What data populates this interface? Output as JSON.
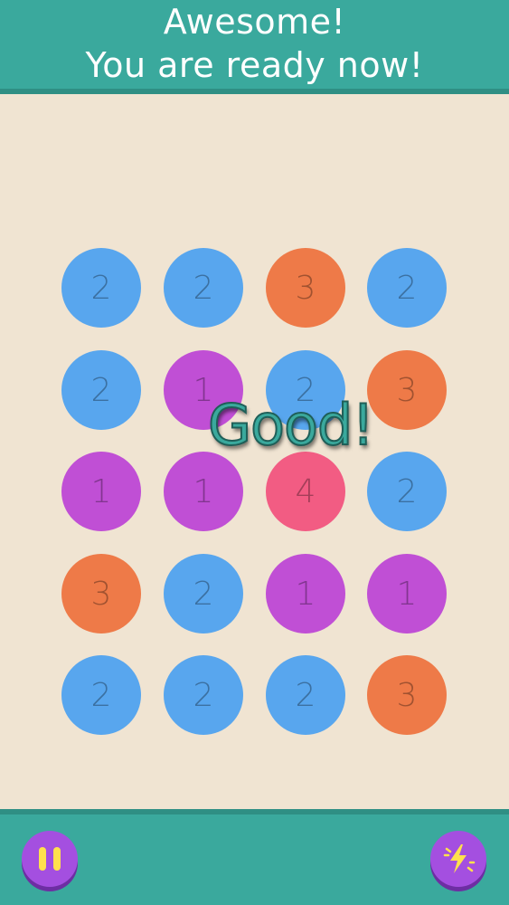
{
  "header": {
    "line1": "Awesome!",
    "line2": "You are ready now!"
  },
  "feedback": {
    "text": "Good!"
  },
  "colors": {
    "blue": "#58a6ee",
    "orange": "#ee7a48",
    "purple": "#c04fd5",
    "pink": "#f25c83",
    "teal": "#3aa99d",
    "button": "#a44fe0",
    "button_icon": "#ffe14d"
  },
  "board": {
    "rows": [
      [
        {
          "value": "2",
          "color": "blue"
        },
        {
          "value": "2",
          "color": "blue"
        },
        {
          "value": "3",
          "color": "orange"
        },
        {
          "value": "2",
          "color": "blue"
        }
      ],
      [
        {
          "value": "2",
          "color": "blue"
        },
        {
          "value": "1",
          "color": "purple"
        },
        {
          "value": "2",
          "color": "blue"
        },
        {
          "value": "3",
          "color": "orange"
        }
      ],
      [
        {
          "value": "1",
          "color": "purple"
        },
        {
          "value": "1",
          "color": "purple"
        },
        {
          "value": "4",
          "color": "pink"
        },
        {
          "value": "2",
          "color": "blue"
        }
      ],
      [
        {
          "value": "3",
          "color": "orange"
        },
        {
          "value": "2",
          "color": "blue"
        },
        {
          "value": "1",
          "color": "purple"
        },
        {
          "value": "1",
          "color": "purple"
        }
      ],
      [
        {
          "value": "2",
          "color": "blue"
        },
        {
          "value": "2",
          "color": "blue"
        },
        {
          "value": "2",
          "color": "blue"
        },
        {
          "value": "3",
          "color": "orange"
        }
      ]
    ]
  },
  "footer": {
    "left_icon": "pause-icon",
    "right_icon": "lightning-icon"
  }
}
